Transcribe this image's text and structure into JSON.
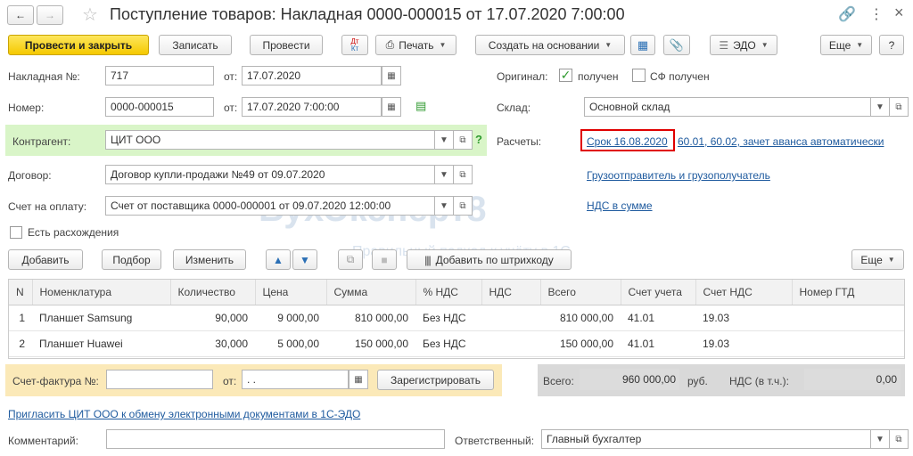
{
  "window": {
    "title": "Поступление товаров: Накладная 0000-000015 от 17.07.2020 7:00:00"
  },
  "toolbar": {
    "post_close": "Провести и закрыть",
    "save": "Записать",
    "post": "Провести",
    "dt_kt": "Дт Кт",
    "print": "Печать",
    "create_basis": "Создать на основании",
    "edo": "ЭДО",
    "more": "Еще",
    "help": "?"
  },
  "header": {
    "invoice_no_label": "Накладная №:",
    "invoice_no": "717",
    "invoice_date_from_label": "от:",
    "invoice_date": "17.07.2020",
    "original_label": "Оригинал:",
    "original_received": "получен",
    "sf_received": "СФ получен",
    "number_label": "Номер:",
    "number": "0000-000015",
    "number_date_from_label": "от:",
    "number_date": "17.07.2020  7:00:00",
    "warehouse_label": "Склад:",
    "warehouse": "Основной склад",
    "contractor_label": "Контрагент:",
    "contractor": "ЦИТ ООО",
    "settlements_label": "Расчеты:",
    "settlements_term": "Срок 16.08.2020",
    "settlements_rest": "60.01, 60.02, зачет аванса автоматически",
    "contract_label": "Договор:",
    "contract": "Договор купли-продажи №49 от 09.07.2020",
    "consignor_link": "Грузоотправитель и грузополучатель",
    "bill_label": "Счет на оплату:",
    "bill": "Счет от поставщика 0000-000001 от 09.07.2020 12:00:00",
    "vat_link": "НДС в сумме",
    "discrepancy": "Есть расхождения"
  },
  "watermark": {
    "name": "БухЭксперт8",
    "tagline": "Правильный подход к учёту в 1С"
  },
  "table_toolbar": {
    "add": "Добавить",
    "pick": "Подбор",
    "change": "Изменить",
    "add_barcode": "Добавить по штрихкоду",
    "more": "Еще"
  },
  "table": {
    "columns": [
      "N",
      "Номенклатура",
      "Количество",
      "Цена",
      "Сумма",
      "% НДС",
      "НДС",
      "Всего",
      "Счет учета",
      "Счет НДС",
      "Номер ГТД"
    ],
    "rows": [
      [
        "1",
        "Планшет Samsung",
        "90,000",
        "9 000,00",
        "810 000,00",
        "Без НДС",
        "",
        "810 000,00",
        "41.01",
        "19.03",
        ""
      ],
      [
        "2",
        "Планшет Huawei",
        "30,000",
        "5 000,00",
        "150 000,00",
        "Без НДС",
        "",
        "150 000,00",
        "41.01",
        "19.03",
        ""
      ]
    ]
  },
  "footer": {
    "sf_label": "Счет-фактура №:",
    "sf_from_label": "от:",
    "sf_date": " .  .",
    "register": "Зарегистрировать",
    "total_label": "Всего:",
    "total_value": "960 000,00",
    "currency": "руб.",
    "vat_label": "НДС (в т.ч.):",
    "vat_value": "0,00",
    "invite_link": "Пригласить ЦИТ ООО к обмену электронными документами в 1С-ЭДО",
    "comment_label": "Комментарий:",
    "responsible_label": "Ответственный:",
    "responsible": "Главный бухгалтер"
  },
  "colors": {
    "accent_yellow": "#f5c900",
    "contractor_bg": "#d9f5c8",
    "sf_bg": "#fbe9b8",
    "totals_bg": "#d9d9d9",
    "link": "#1e5a9e",
    "highlight_box": "#e00000"
  }
}
